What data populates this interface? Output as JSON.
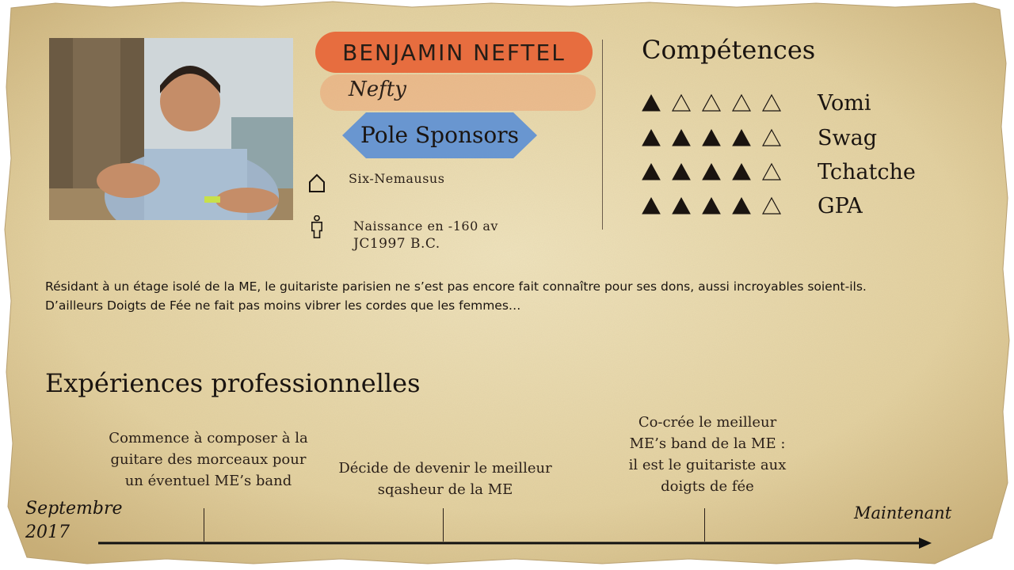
{
  "profile": {
    "name": "BENJAMIN NEFTEL",
    "nickname": "Nefty",
    "pole": "Pole Sponsors",
    "location": "Six-Nemausus",
    "birth_line1": "Naissance en -160 av",
    "birth_line2": "JC1997 B.C.",
    "home_icon": "home-icon",
    "person_icon": "person-icon"
  },
  "skills": {
    "title": "Compétences",
    "max": 5,
    "items": [
      {
        "label": "Vomi",
        "level": 1
      },
      {
        "label": "Swag",
        "level": 4
      },
      {
        "label": "Tchatche",
        "level": 4
      },
      {
        "label": "GPA",
        "level": 4
      }
    ]
  },
  "bio": {
    "line1": "Résidant à un étage isolé de la ME, le guitariste parisien ne s’est pas encore fait connaître pour ses dons, aussi incroyables soient-ils.",
    "line2": "D’ailleurs Doigts de Fée ne fait pas moins vibrer les cordes que les femmes…"
  },
  "experience": {
    "title": "Expériences professionnelles",
    "start_line1": "Septembre",
    "start_line2": "2017",
    "end": "Maintenant",
    "events": [
      {
        "lines": [
          "Commence à composer à la",
          "guitare des morceaux pour",
          "un éventuel ME’s band"
        ]
      },
      {
        "lines": [
          "Décide de devenir le meilleur",
          "sqasheur de la ME"
        ]
      },
      {
        "lines": [
          "Co-crée le meilleur",
          "ME’s band de la ME :",
          "il est le guitariste aux",
          "doigts de fée"
        ]
      }
    ]
  },
  "colors": {
    "parchment": "#e6d6a8",
    "name_banner": "#e8683a",
    "pole_banner": "#5b8fd4",
    "ink": "#1a1410"
  }
}
